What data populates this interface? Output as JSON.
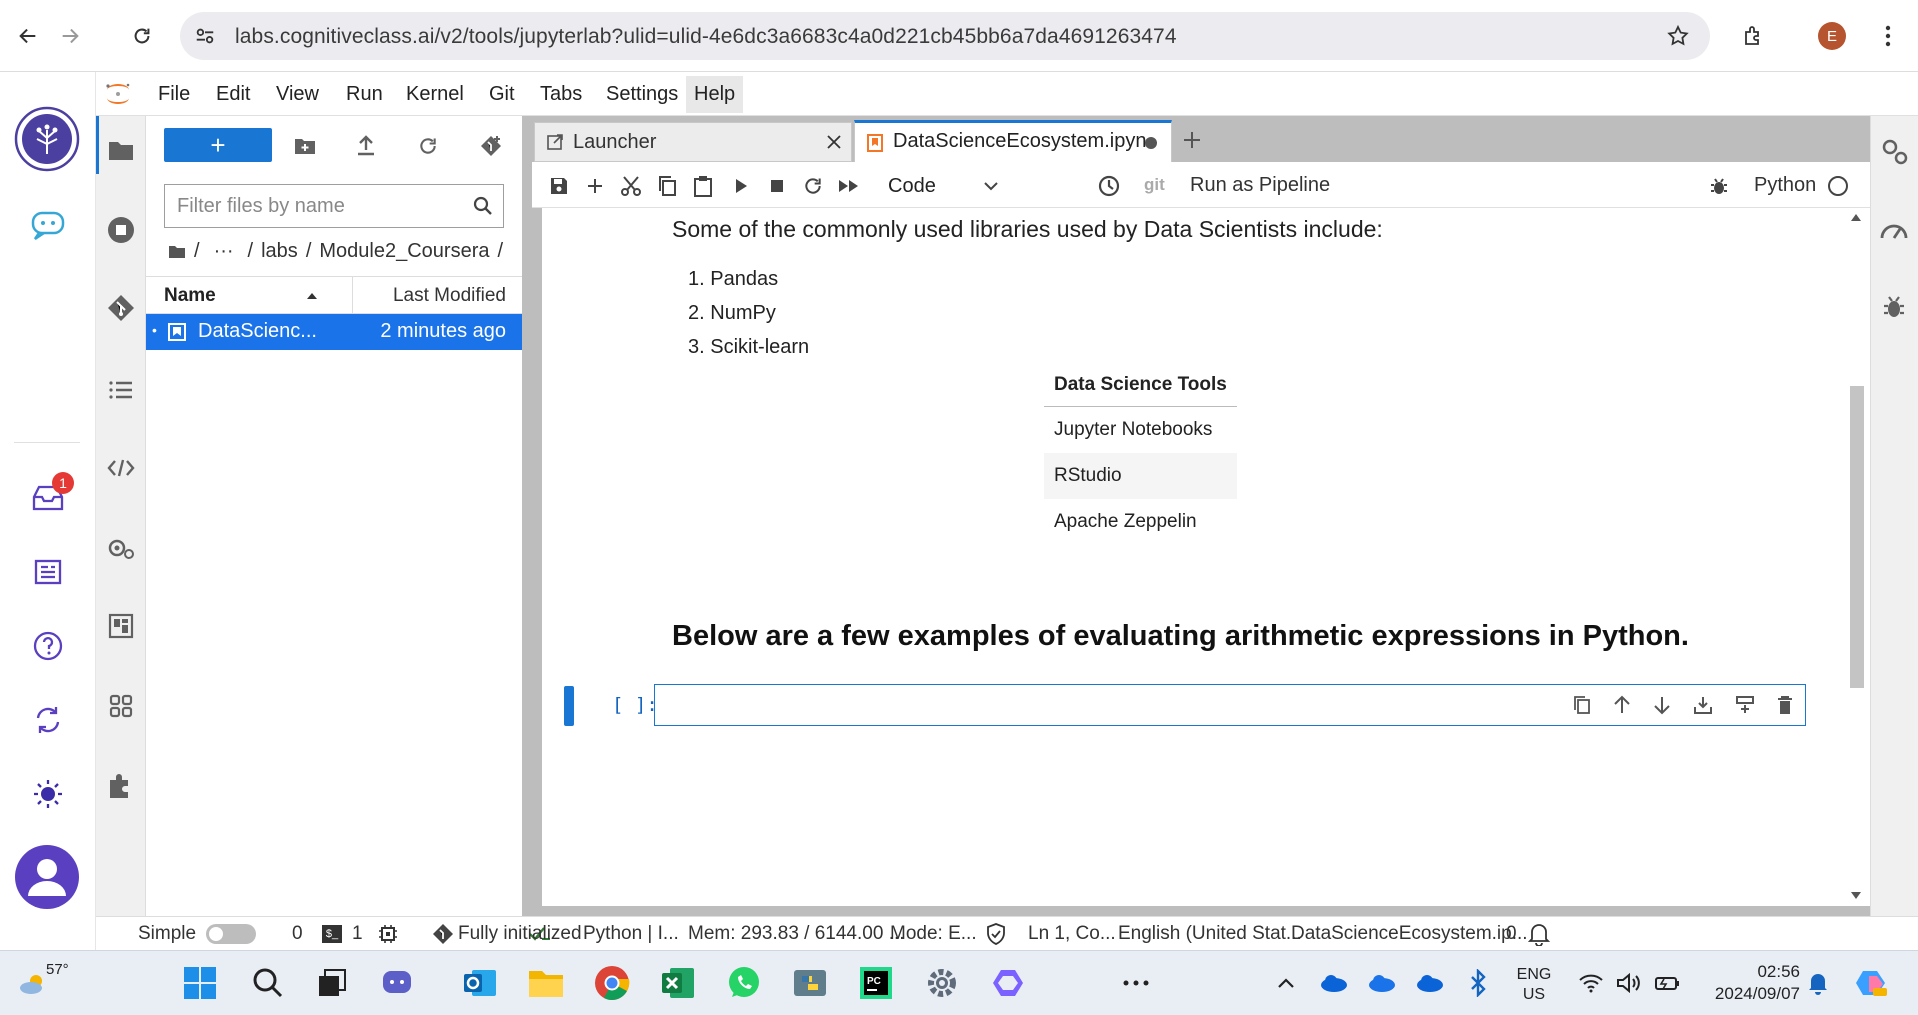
{
  "browser": {
    "url": "labs.cognitiveclass.ai/v2/tools/jupyterlab?ulid=ulid-4e6dc3a6683c4a0d221cb45bb6a7da4691263474",
    "profile_initial": "E"
  },
  "rail": {
    "inbox_badge": "1"
  },
  "menubar": {
    "items": [
      "File",
      "Edit",
      "View",
      "Run",
      "Kernel",
      "Git",
      "Tabs",
      "Settings",
      "Help"
    ]
  },
  "filebrowser": {
    "new_button": "+",
    "filter_placeholder": "Filter files by name",
    "breadcrumb": {
      "root": "/",
      "ellipsis": "···",
      "sep1": "/",
      "dir1": "labs",
      "sep2": "/",
      "dir2": "Module2_Coursera",
      "sep3": "/"
    },
    "col_name": "Name",
    "col_modified": "Last Modified",
    "files": [
      {
        "name": "DataScienc...",
        "modified": "2 minutes ago"
      }
    ]
  },
  "tabs": [
    {
      "label": "Launcher"
    },
    {
      "label": "DataScienceEcosystem.ipyn"
    }
  ],
  "toolbar": {
    "cell_type": "Code",
    "git_label": "git",
    "pipeline_label": "Run as Pipeline",
    "kernel_name": "Python"
  },
  "notebook": {
    "intro": "Some of the commonly used libraries used by Data Scientists include:",
    "libraries": [
      "Pandas",
      "NumPy",
      "Scikit-learn"
    ],
    "table_header": "Data Science Tools",
    "table_rows": [
      "Jupyter Notebooks",
      "RStudio",
      "Apache Zeppelin"
    ],
    "heading": "Below are a few examples of evaluating arithmetic expressions in Python.",
    "prompt": "[ ]:"
  },
  "status": {
    "mode": "Simple",
    "terminals": "0",
    "kernels": "1",
    "init": "Fully initialized",
    "kernel": "Python | I...",
    "mem": "Mem: 293.83 / 6144.00 ...",
    "editmode": "Mode: E...",
    "cursor": "Ln 1, Co...",
    "lang": "English (United Stat...",
    "file": "DataScienceEcosystem.ip...",
    "notifications": "0"
  },
  "taskbar": {
    "weather": "57°",
    "lang_line1": "ENG",
    "lang_line2": "US",
    "time": "02:56",
    "date": "2024/09/07"
  },
  "colors": {
    "jupyter_blue": "#1976d2",
    "selected_row": "#1a73e8",
    "orange": "#f37726"
  }
}
